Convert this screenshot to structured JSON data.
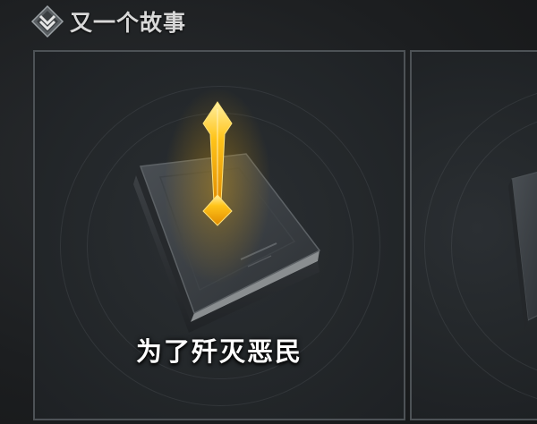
{
  "header": {
    "title": "又一个故事",
    "icon": "chevron-badge-icon"
  },
  "cards": [
    {
      "label": "为了歼灭恶民",
      "icon": "book-icon",
      "badge_icon": "exclamation-quest-icon",
      "accent_color": "#f5b800"
    },
    {
      "label": "",
      "icon": "book-icon"
    }
  ],
  "colors": {
    "background": "#1c1e20",
    "card_border": "#4d5256",
    "quest_marker": "#f5b800",
    "text": "#ffffff"
  }
}
